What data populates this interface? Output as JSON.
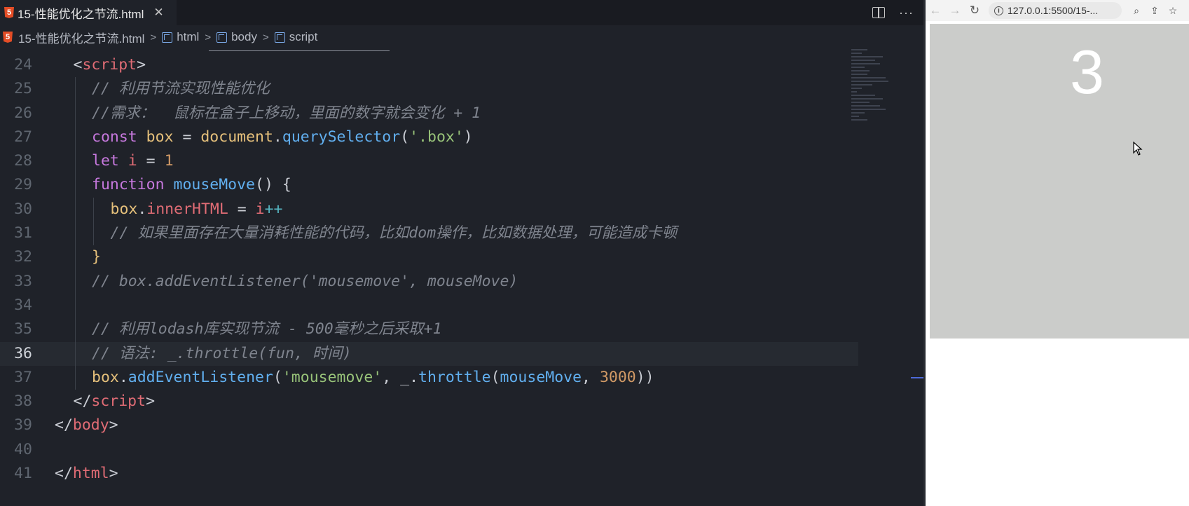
{
  "editor": {
    "tab": {
      "filename": "15-性能优化之节流.html",
      "close": "✕",
      "file_icon": "html5-icon"
    },
    "breadcrumb": [
      "15-性能优化之节流.html",
      "html",
      "body",
      "script"
    ],
    "lines": [
      {
        "n": "24",
        "indent": 1,
        "tokens": [
          [
            "punc",
            "<"
          ],
          [
            "tag",
            "script"
          ],
          [
            "punc",
            ">"
          ]
        ]
      },
      {
        "n": "25",
        "indent": 2,
        "tokens": [
          [
            "cm",
            "// 利用节流实现性能优化"
          ]
        ]
      },
      {
        "n": "26",
        "indent": 2,
        "tokens": [
          [
            "cm",
            "//需求：  鼠标在盒子上移动，里面的数字就会变化 + 1"
          ]
        ]
      },
      {
        "n": "27",
        "indent": 2,
        "tokens": [
          [
            "kw",
            "const "
          ],
          [
            "vr",
            "box"
          ],
          [
            "punc",
            " = "
          ],
          [
            "vr",
            "document"
          ],
          [
            "punc",
            "."
          ],
          [
            "fn",
            "querySelector"
          ],
          [
            "punc",
            "("
          ],
          [
            "str",
            "'.box'"
          ],
          [
            "punc",
            ")"
          ]
        ]
      },
      {
        "n": "28",
        "indent": 2,
        "tokens": [
          [
            "kw",
            "let "
          ],
          [
            "prop",
            "i"
          ],
          [
            "punc",
            " = "
          ],
          [
            "num",
            "1"
          ]
        ]
      },
      {
        "n": "29",
        "indent": 2,
        "tokens": [
          [
            "kw",
            "function "
          ],
          [
            "fn",
            "mouseMove"
          ],
          [
            "punc",
            "() {"
          ]
        ]
      },
      {
        "n": "30",
        "indent": 3,
        "tokens": [
          [
            "vr",
            "box"
          ],
          [
            "punc",
            "."
          ],
          [
            "prop",
            "innerHTML"
          ],
          [
            "punc",
            " = "
          ],
          [
            "prop",
            "i"
          ],
          [
            "op",
            "++"
          ]
        ]
      },
      {
        "n": "31",
        "indent": 3,
        "tokens": [
          [
            "cm",
            "// 如果里面存在大量消耗性能的代码，比如dom操作，比如数据处理，可能造成卡顿"
          ]
        ]
      },
      {
        "n": "32",
        "indent": 2,
        "tokens": [
          [
            "vr",
            "}"
          ]
        ]
      },
      {
        "n": "33",
        "indent": 2,
        "tokens": [
          [
            "cm",
            "// box.addEventListener('mousemove', mouseMove)"
          ]
        ]
      },
      {
        "n": "34",
        "indent": 2,
        "tokens": []
      },
      {
        "n": "35",
        "indent": 2,
        "tokens": [
          [
            "cm",
            "// 利用lodash库实现节流 - 500毫秒之后采取+1"
          ]
        ]
      },
      {
        "n": "36",
        "indent": 2,
        "tokens": [
          [
            "cm",
            "// 语法: _.throttle(fun, 时间)"
          ]
        ]
      },
      {
        "n": "37",
        "indent": 2,
        "tokens": [
          [
            "vr",
            "box"
          ],
          [
            "punc",
            "."
          ],
          [
            "fn",
            "addEventListener"
          ],
          [
            "punc",
            "("
          ],
          [
            "str",
            "'mousemove'"
          ],
          [
            "punc",
            ", _."
          ],
          [
            "fn",
            "throttle"
          ],
          [
            "punc",
            "("
          ],
          [
            "fn",
            "mouseMove"
          ],
          [
            "punc",
            ", "
          ],
          [
            "num",
            "3000"
          ],
          [
            "punc",
            "))"
          ]
        ]
      },
      {
        "n": "38",
        "indent": 1,
        "tokens": [
          [
            "punc",
            "</"
          ],
          [
            "tag",
            "script"
          ],
          [
            "punc",
            ">"
          ]
        ]
      },
      {
        "n": "39",
        "indent": 0,
        "tokens": [
          [
            "punc",
            "</"
          ],
          [
            "tag",
            "body"
          ],
          [
            "punc",
            ">"
          ]
        ]
      },
      {
        "n": "40",
        "indent": 0,
        "tokens": []
      },
      {
        "n": "41",
        "indent": 0,
        "tokens": [
          [
            "punc",
            "</"
          ],
          [
            "tag",
            "html"
          ],
          [
            "punc",
            ">"
          ]
        ]
      }
    ],
    "current_line": "36"
  },
  "browser": {
    "url": "127.0.0.1:5500/15-...",
    "box_value": "3"
  }
}
